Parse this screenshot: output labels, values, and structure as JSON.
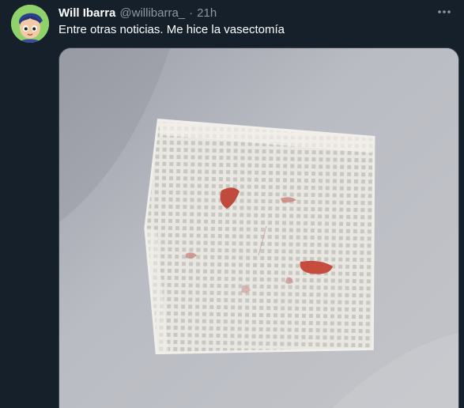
{
  "tweet": {
    "display_name": "Will Ibarra",
    "handle": "@willibarra_",
    "separator": "·",
    "time": "21h",
    "text": "Entre otras noticias. Me hice la vasectomía"
  },
  "icons": {
    "more": "more-horizontal-icon",
    "avatar": "cartoon-avatar"
  },
  "colors": {
    "background": "#15202b",
    "primary_text": "#ffffff",
    "secondary_text": "#8b98a5",
    "avatar_bg": "#8fd16a",
    "media_border": "#38444d"
  }
}
